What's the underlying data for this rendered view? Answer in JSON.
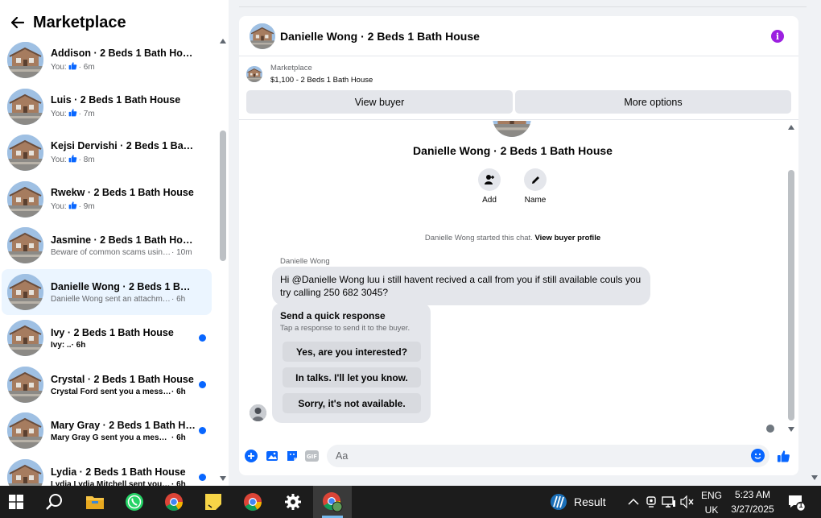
{
  "sidebar": {
    "title": "Marketplace",
    "conversations": [
      {
        "name": "Addison · 2 Beds 1 Bath House",
        "prefix": "You:",
        "thumb": true,
        "message": "",
        "time": "· 6m",
        "unread": false,
        "active": false
      },
      {
        "name": "Luis · 2 Beds 1 Bath House",
        "prefix": "You:",
        "thumb": true,
        "message": "",
        "time": "· 7m",
        "unread": false,
        "active": false
      },
      {
        "name": "Kejsi Dervishi · 2 Beds 1 Bath H...",
        "prefix": "You:",
        "thumb": true,
        "message": "",
        "time": "· 8m",
        "unread": false,
        "active": false
      },
      {
        "name": "Rwekw · 2 Beds 1 Bath House",
        "prefix": "You:",
        "thumb": true,
        "message": "",
        "time": "· 9m",
        "unread": false,
        "active": false
      },
      {
        "name": "Jasmine · 2 Beds 1 Bath House",
        "prefix": "",
        "thumb": false,
        "message": "Beware of common scams using ...",
        "time": "· 10m",
        "unread": false,
        "active": false
      },
      {
        "name": "Danielle Wong · 2 Beds 1 Bath ...",
        "prefix": "",
        "thumb": false,
        "message": "Danielle Wong sent an attachment.",
        "time": "· 6h",
        "unread": false,
        "active": true
      },
      {
        "name": "Ivy · 2 Beds 1 Bath House",
        "prefix": "",
        "thumb": false,
        "message": "Ivy: ..",
        "time": "· 6h",
        "unread": true,
        "active": false
      },
      {
        "name": "Crystal · 2 Beds 1 Bath House",
        "prefix": "",
        "thumb": false,
        "message": "Crystal Ford sent you a messag...",
        "time": "· 6h",
        "unread": true,
        "active": false
      },
      {
        "name": "Mary Gray · 2 Beds 1 Bath Ho...",
        "prefix": "",
        "thumb": false,
        "message": "Mary Gray G sent you a messag...",
        "time": "· 6h",
        "unread": true,
        "active": false
      },
      {
        "name": "Lydia · 2 Beds 1 Bath House",
        "prefix": "",
        "thumb": false,
        "message": "Lydia Lydia Mitchell sent you a ...",
        "time": "· 6h",
        "unread": true,
        "active": false
      }
    ]
  },
  "chat": {
    "title": "Danielle Wong · 2 Beds 1 Bath House",
    "listing": {
      "source": "Marketplace",
      "price_title": "$1,100 - 2 Beds 1 Bath House",
      "view_buyer": "View buyer",
      "more_options": "More options"
    },
    "profile_name": "Danielle Wong · 2 Beds 1 Bath House",
    "actions": {
      "add": "Add",
      "name": "Name"
    },
    "started_text": "Danielle Wong started this chat.",
    "view_profile": "View buyer profile",
    "sender": "Danielle Wong",
    "message": "Hi @Danielle Wong luu  i still havent recived a call from you if still available couls you try calling  250 682 3045?",
    "quick_response": {
      "title": "Send a quick response",
      "subtitle": "Tap a response to send it to the buyer.",
      "options": [
        "Yes, are you interested?",
        "In talks. I'll let you know.",
        "Sorry, it's not available."
      ]
    },
    "composer_placeholder": "Aa"
  },
  "taskbar": {
    "result_label": "Result",
    "lang_top": "ENG",
    "lang_bottom": "UK",
    "time": "5:23 AM",
    "date": "3/27/2025",
    "notification_count": "1"
  },
  "colors": {
    "accent": "#0866ff",
    "info": "#9c20e0",
    "active_row": "#ebf5ff"
  }
}
